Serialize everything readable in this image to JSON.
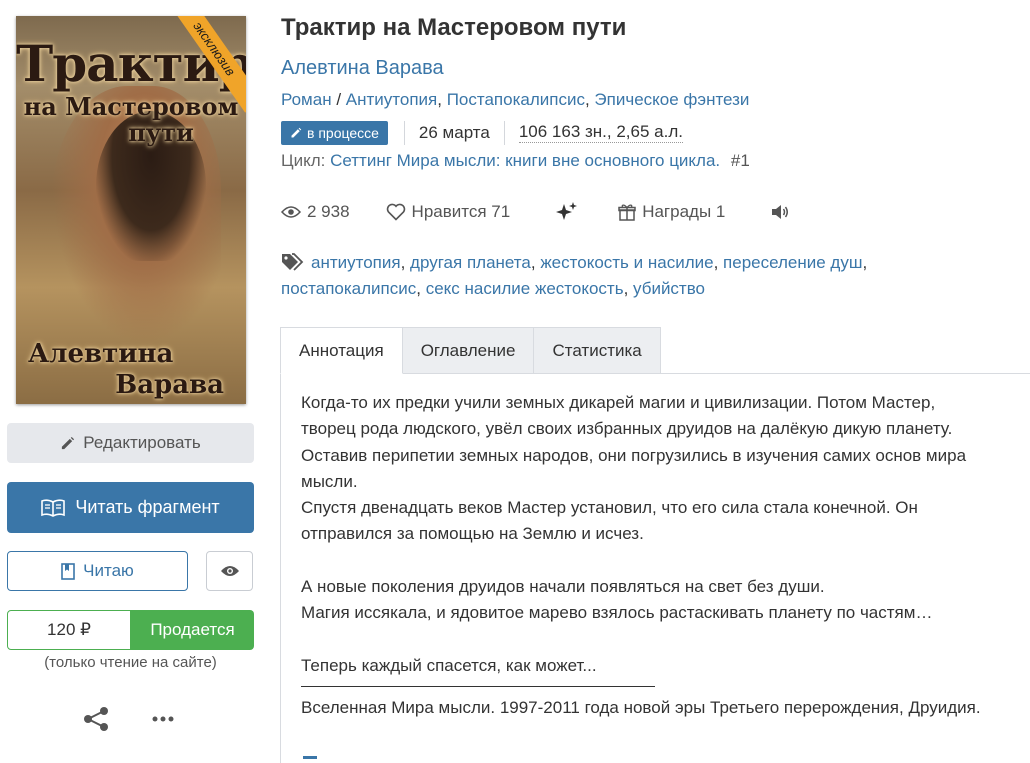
{
  "book": {
    "title": "Трактир на Мастеровом пути",
    "author": "Алевтина Варава",
    "genres": [
      "Роман",
      "Антиутопия",
      "Постапокалипсис",
      "Эпическое фэнтези"
    ],
    "status_badge": "в процессе",
    "date": "26 марта",
    "size": "106 163 зн., 2,65 а.л.",
    "cycle_label": "Цикл:",
    "cycle_name": "Сеттинг Мира мысли: книги вне основного цикла.",
    "cycle_number": "#1"
  },
  "cover": {
    "title_line1": "Трактир",
    "title_line2": "на Мастеровом",
    "title_line3": "пути",
    "author_line1": "Алевтина",
    "author_line2": "Варава",
    "ribbon": "эксклюзив"
  },
  "stats": {
    "views": "2 938",
    "likes_label": "Нравится 71",
    "awards_label": "Награды 1"
  },
  "tags": [
    "антиутопия",
    "другая планета",
    "жестокость и насилие",
    "переселение душ",
    "постапокалипсис",
    "секс насилие жестокость",
    "убийство"
  ],
  "actions": {
    "edit": "Редактировать",
    "read_fragment": "Читать фрагмент",
    "reading": "Читаю",
    "price": "120 ₽",
    "sale": "Продается",
    "price_note": "(только чтение на сайте)"
  },
  "tabs": [
    "Аннотация",
    "Оглавление",
    "Статистика"
  ],
  "annotation": {
    "l1": "Когда-то их предки учили земных дикарей магии и цивилизации. Потом Мастер,",
    "l2": "творец рода людского, увёл своих избранных друидов на далёкую дикую планету.",
    "l3": "Оставив перипетии земных народов, они погрузились в изучения самих основ мира",
    "l4": "мысли.",
    "l5": "Спустя двенадцать веков Мастер установил, что его сила стала конечной. Он",
    "l6": "отправился за помощью на Землю и исчез.",
    "l7": "А новые поколения друидов начали появляться на свет без души.",
    "l8": "Магия иссякала, и ядовитое марево взялось растаскивать планету по частям…",
    "l9": "Теперь каждый спасется, как может...",
    "l10": "Вселенная Мира мысли. 1997-2011 года новой эры Третьего перерождения, Друидия."
  },
  "colors": {
    "accent": "#3a76a8",
    "sale": "#4caf50",
    "ribbon": "#f0a429"
  }
}
